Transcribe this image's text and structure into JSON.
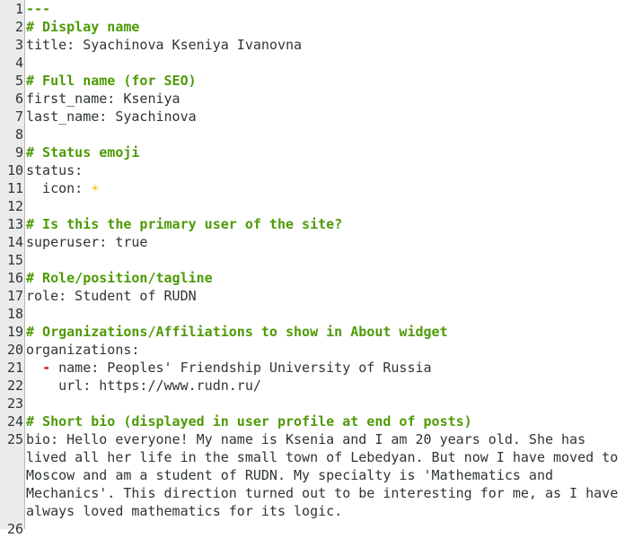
{
  "editor": {
    "colors": {
      "comment": "#4e9a06",
      "list_dash": "#cc0000",
      "emoji": "#f5c211"
    },
    "lines": [
      {
        "n": "1",
        "type": "sep",
        "text": "---"
      },
      {
        "n": "2",
        "type": "comment",
        "text": "# Display name"
      },
      {
        "n": "3",
        "type": "plain",
        "text": "title: Syachinova Kseniya Ivanovna"
      },
      {
        "n": "4",
        "type": "plain",
        "text": ""
      },
      {
        "n": "5",
        "type": "comment",
        "text": "# Full name (for SEO)"
      },
      {
        "n": "6",
        "type": "plain",
        "text": "first_name: Kseniya"
      },
      {
        "n": "7",
        "type": "plain",
        "text": "last_name: Syachinova"
      },
      {
        "n": "8",
        "type": "plain",
        "text": ""
      },
      {
        "n": "9",
        "type": "comment",
        "text": "# Status emoji"
      },
      {
        "n": "10",
        "type": "plain",
        "text": "status:"
      },
      {
        "n": "11",
        "type": "emoji",
        "text": "  icon: ",
        "emoji": "☀️"
      },
      {
        "n": "12",
        "type": "plain",
        "text": ""
      },
      {
        "n": "13",
        "type": "comment",
        "text": "# Is this the primary user of the site?"
      },
      {
        "n": "14",
        "type": "plain",
        "text": "superuser: true"
      },
      {
        "n": "15",
        "type": "plain",
        "text": ""
      },
      {
        "n": "16",
        "type": "comment",
        "text": "# Role/position/tagline"
      },
      {
        "n": "17",
        "type": "plain",
        "text": "role: Student of RUDN"
      },
      {
        "n": "18",
        "type": "plain",
        "text": ""
      },
      {
        "n": "19",
        "type": "comment",
        "text": "# Organizations/Affiliations to show in About widget"
      },
      {
        "n": "20",
        "type": "plain",
        "text": "organizations:"
      },
      {
        "n": "21",
        "type": "dash",
        "text": " name: Peoples' Friendship University of Russia"
      },
      {
        "n": "22",
        "type": "plain",
        "text": "    url: https://www.rudn.ru/"
      },
      {
        "n": "23",
        "type": "plain",
        "text": ""
      },
      {
        "n": "24",
        "type": "comment",
        "text": "# Short bio (displayed in user profile at end of posts)"
      },
      {
        "n": "25",
        "type": "plain",
        "text": "bio: Hello everyone! My name is Ksenia and I am 20 years old. She has"
      },
      {
        "n": "",
        "type": "plain",
        "text": "lived all her life in the small town of Lebedyan. But now I have moved to"
      },
      {
        "n": "",
        "type": "plain",
        "text": "Moscow and am a student of RUDN. My specialty is 'Mathematics and"
      },
      {
        "n": "",
        "type": "plain",
        "text": "Mechanics'. This direction turned out to be interesting for me, as I have"
      },
      {
        "n": "",
        "type": "plain",
        "text": "always loved mathematics for its logic."
      },
      {
        "n": "26",
        "type": "plain",
        "text": ""
      }
    ]
  }
}
